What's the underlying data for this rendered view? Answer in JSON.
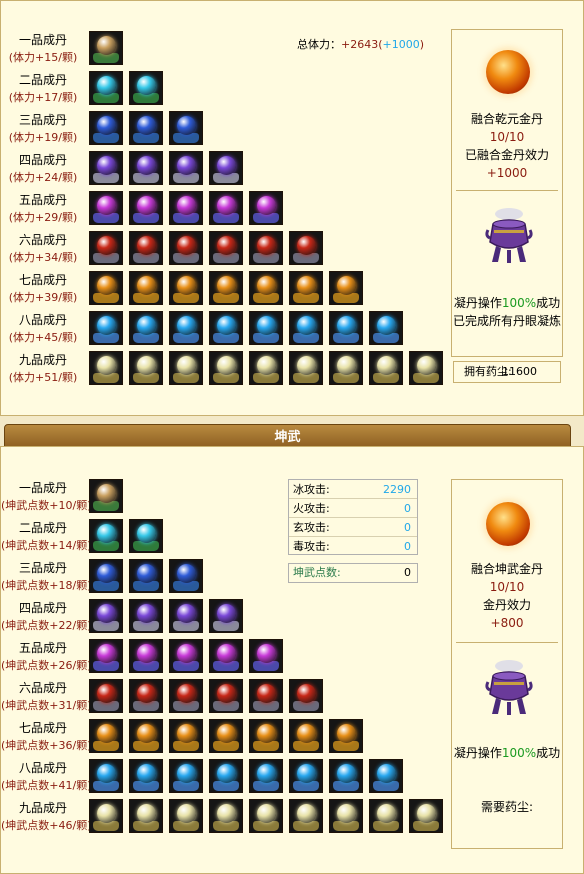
{
  "colors": {
    "grade1": "#c9a060",
    "grade2": "#35c8e8",
    "grade3": "#2f5cd8",
    "grade4": "#7a48d8",
    "grade5": "#c83ad8",
    "grade6": "#c82818",
    "grade7": "#e89018",
    "grade8": "#28a8f0",
    "grade9": "#e8e2a8",
    "ped1": "#3a7a3a",
    "ped2": "#2f7a3a",
    "ped3": "#2a5a9a",
    "ped4": "#8a8a9a",
    "ped5": "#4a4aaa",
    "ped6": "#6a6a7a",
    "ped7": "#a8781a",
    "ped8": "#3a6aaa",
    "ped9": "#8a7a3a"
  },
  "section1": {
    "rows": [
      {
        "name": "一品成丹",
        "bonus": "(体力+15/颗)"
      },
      {
        "name": "二品成丹",
        "bonus": "(体力+17/颗)"
      },
      {
        "name": "三品成丹",
        "bonus": "(体力+19/颗)"
      },
      {
        "name": "四品成丹",
        "bonus": "(体力+24/颗)"
      },
      {
        "name": "五品成丹",
        "bonus": "(体力+29/颗)"
      },
      {
        "name": "六品成丹",
        "bonus": "(体力+34/颗)"
      },
      {
        "name": "七品成丹",
        "bonus": "(体力+39/颗)"
      },
      {
        "name": "八品成丹",
        "bonus": "(体力+45/颗)"
      },
      {
        "name": "九品成丹",
        "bonus": "(体力+51/颗)"
      }
    ],
    "total_label": "总体力：",
    "total_value": "+2643(",
    "total_bonus": "+1000",
    "total_close": ")",
    "fuse_title": "融合乾元金丹",
    "fuse_count": "10/10",
    "fuse_status": "已融合金丹效力",
    "fuse_value": "+1000",
    "refine_prefix": "凝丹操作",
    "refine_rate": "100%",
    "refine_suffix": "成功",
    "refine_note": "已完成所有丹眼凝炼",
    "herb_label": "拥有药尘:",
    "herb_value": "11600"
  },
  "banner": {
    "title": "坤武"
  },
  "section2": {
    "rows": [
      {
        "name": "一品成丹",
        "bonus": "(坤武点数+10/颗)"
      },
      {
        "name": "二品成丹",
        "bonus": "(坤武点数+14/颗)"
      },
      {
        "name": "三品成丹",
        "bonus": "(坤武点数+18/颗)"
      },
      {
        "name": "四品成丹",
        "bonus": "(坤武点数+22/颗)"
      },
      {
        "name": "五品成丹",
        "bonus": "(坤武点数+26/颗)"
      },
      {
        "name": "六品成丹",
        "bonus": "(坤武点数+31/颗)"
      },
      {
        "name": "七品成丹",
        "bonus": "(坤武点数+36/颗)"
      },
      {
        "name": "八品成丹",
        "bonus": "(坤武点数+41/颗)"
      },
      {
        "name": "九品成丹",
        "bonus": "(坤武点数+46/颗)"
      }
    ],
    "attacks": [
      {
        "label": "冰攻击:",
        "value": "2290"
      },
      {
        "label": "火攻击:",
        "value": "0"
      },
      {
        "label": "玄攻击:",
        "value": "0"
      },
      {
        "label": "毒攻击:",
        "value": "0"
      }
    ],
    "points_label": "坤武点数:",
    "points_value": "0",
    "fuse_title": "融合坤武金丹",
    "fuse_count": "10/10",
    "fuse_status": "金丹效力",
    "fuse_value": "+800",
    "refine_prefix": "凝丹操作",
    "refine_rate": "100%",
    "refine_suffix": "成功",
    "herb_label": "需要药尘:"
  }
}
